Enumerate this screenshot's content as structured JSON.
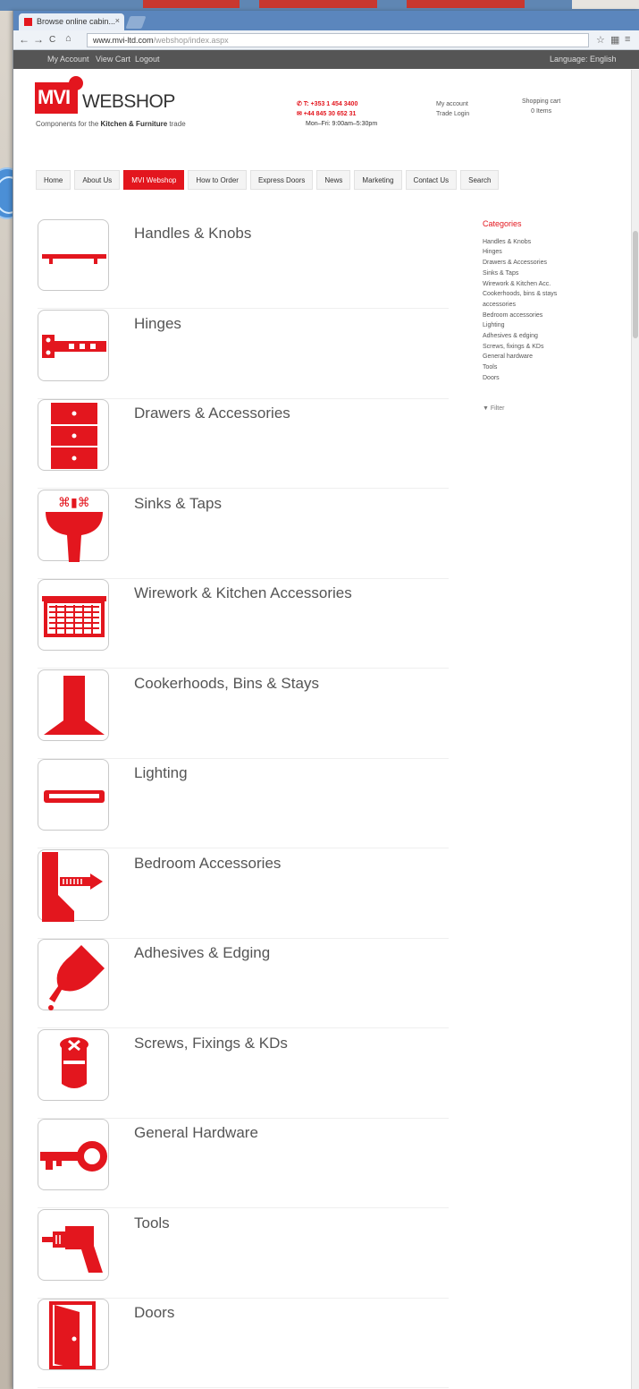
{
  "browser": {
    "tab_title": "Browse online cabin...",
    "tab_close": "×",
    "url_domain": "www.mvi-ltd.com",
    "url_path": "/webshop/index.aspx",
    "nav_back": "←",
    "nav_forward": "→",
    "nav_reload": "C",
    "site_links": [
      "My Account",
      "View Cart",
      "Logout"
    ],
    "site_right": "Language: English"
  },
  "header": {
    "logo_mark": "MVI",
    "logo_text": "WEBSHOP",
    "tagline_prefix": "Components for the",
    "tagline_bold": "Kitchen & Furniture",
    "tagline_suffix": "trade",
    "phone1": "✆ T: +353 1 454 3400",
    "phone2": "✉ +44 845 30 652 31",
    "hours": "Mon–Fri: 9:00am–5:30pm",
    "account_link": "My account",
    "account_sub": "Trade Login",
    "cart_title": "Shopping cart",
    "cart_count": "0 Items"
  },
  "nav": [
    "Home",
    "About Us",
    "MVI Webshop",
    "How to Order",
    "Express Doors",
    "News",
    "Marketing",
    "Contact Us",
    "Search"
  ],
  "nav_active": "MVI Webshop",
  "categories": [
    {
      "label": "Handles & Knobs",
      "icon": "handle-icon"
    },
    {
      "label": "Hinges",
      "icon": "hinge-icon"
    },
    {
      "label": "Drawers & Accessories",
      "icon": "drawers-icon"
    },
    {
      "label": "Sinks & Taps",
      "icon": "sink-icon"
    },
    {
      "label": "Wirework & Kitchen Accessories",
      "icon": "basket-icon"
    },
    {
      "label": "Cookerhoods, Bins & Stays",
      "icon": "cookerhood-icon"
    },
    {
      "label": "Lighting",
      "icon": "light-icon"
    },
    {
      "label": "Bedroom Accessories",
      "icon": "screw-wall-icon"
    },
    {
      "label": "Adhesives & Edging",
      "icon": "glue-icon"
    },
    {
      "label": "Screws, Fixings & KDs",
      "icon": "fixing-icon"
    },
    {
      "label": "General Hardware",
      "icon": "key-icon"
    },
    {
      "label": "Tools",
      "icon": "drill-icon"
    },
    {
      "label": "Doors",
      "icon": "door-icon"
    }
  ],
  "sidebar": {
    "heading": "Categories",
    "items": [
      "Handles & Knobs",
      "Hinges",
      "Drawers & Accessories",
      "Sinks & Taps",
      "Wirework & Kitchen Acc.",
      "Cookerhoods, bins & stays",
      "accessories",
      "Bedroom accessories",
      "Lighting",
      "Adhesives & edging",
      "Screws, fixings & KDs",
      "General hardware",
      "Tools",
      "Doors"
    ],
    "filter": "▼ Filter"
  },
  "colors": {
    "brand_red": "#e3161e",
    "text_grey": "#555555"
  }
}
